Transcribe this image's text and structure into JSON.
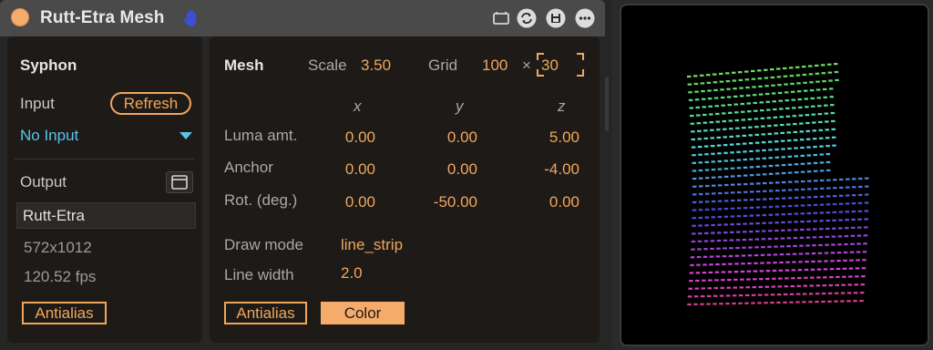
{
  "device": {
    "title": "Rutt-Etra Mesh",
    "icons": [
      "power-toggle-icon",
      "hand-icon",
      "keyboard-map-icon",
      "sync-icon",
      "save-icon",
      "more-icon"
    ]
  },
  "syphon": {
    "header": "Syphon",
    "input_label": "Input",
    "refresh_label": "Refresh",
    "input_value": "No Input",
    "output_label": "Output",
    "output_name": "Rutt-Etra",
    "resolution": "572x1012",
    "fps": "120.52 fps",
    "antialias_label": "Antialias"
  },
  "mesh": {
    "header": "Mesh",
    "scale_label": "Scale",
    "scale_value": "3.50",
    "grid_label": "Grid",
    "grid_x": "100",
    "grid_times": "×",
    "grid_y": "30",
    "axis_x": "x",
    "axis_y": "y",
    "axis_z": "z",
    "rows": [
      {
        "label": "Luma amt.",
        "x": "0.00",
        "y": "0.00",
        "z": "5.00"
      },
      {
        "label": "Anchor",
        "x": "0.00",
        "y": "0.00",
        "z": "-4.00"
      },
      {
        "label": "Rot. (deg.)",
        "x": "0.00",
        "y": "-50.00",
        "z": "0.00"
      }
    ],
    "draw_mode_label": "Draw mode",
    "draw_mode_value": "line_strip",
    "line_width_label": "Line width",
    "line_width_value": "2.0",
    "antialias_label": "Antialias",
    "color_label": "Color"
  },
  "colors": {
    "accent": "#f2a65a",
    "input_blue": "#58c4e8",
    "panel": "#1d1a18"
  }
}
